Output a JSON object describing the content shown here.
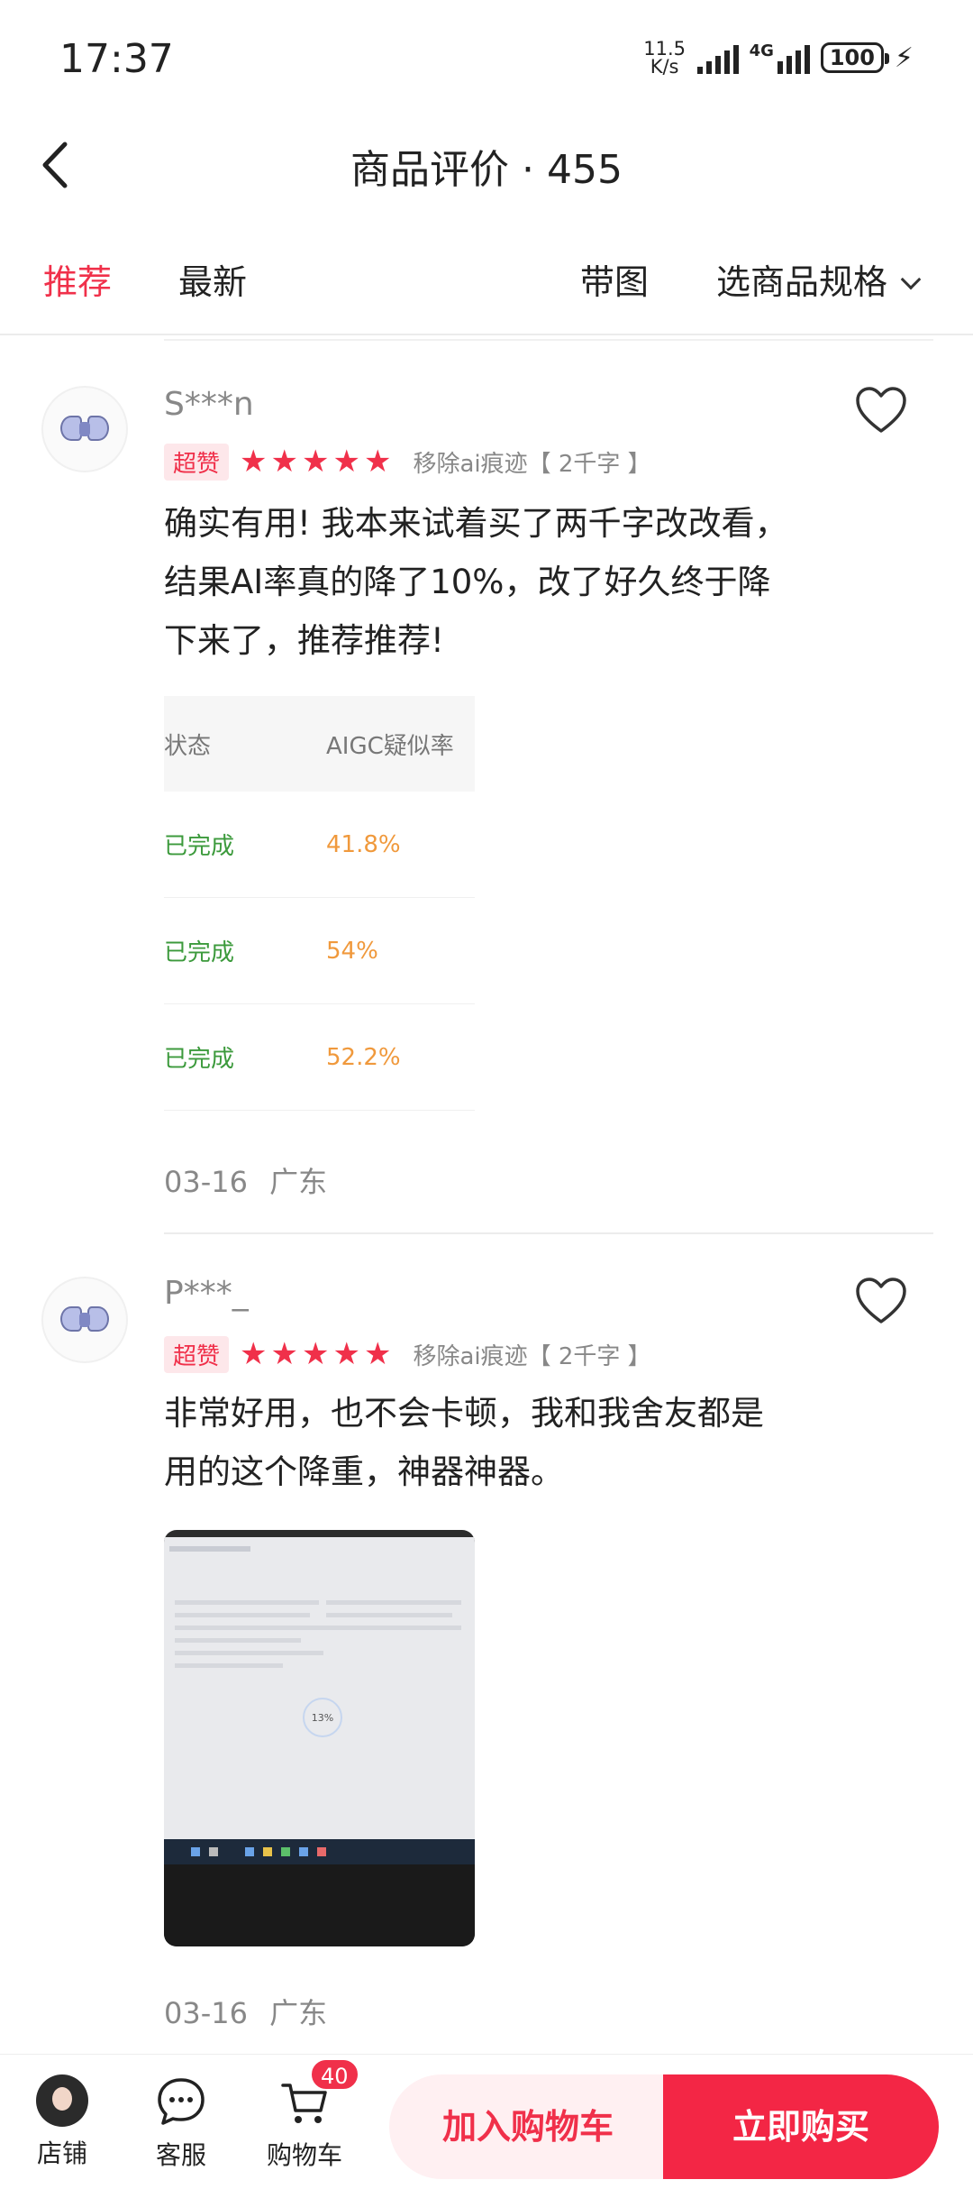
{
  "status_bar": {
    "time": "17:37",
    "net_speed_value": "11.5",
    "net_speed_unit": "K/s",
    "network_type": "4G",
    "battery": "100"
  },
  "header": {
    "title": "商品评价 · 455"
  },
  "tabs": {
    "recommend": "推荐",
    "latest": "最新",
    "with_images": "带图",
    "select_spec": "选商品规格"
  },
  "reviews": [
    {
      "username": "S***n",
      "badge": "超赞",
      "rating": 5,
      "spec": "移除ai痕迹【 2千字 】",
      "content": "确实有用! 我本来试着买了两千字改改看，结果AI率真的降了10%，改了好久终于降下来了，推荐推荐!",
      "image_table": {
        "headers": [
          "状态",
          "AIGC疑似率"
        ],
        "rows": [
          [
            "已完成",
            "41.8%"
          ],
          [
            "已完成",
            "54%"
          ],
          [
            "已完成",
            "52.2%"
          ]
        ]
      },
      "date": "03-16",
      "location": "广东"
    },
    {
      "username": "P***_",
      "badge": "超赞",
      "rating": 5,
      "spec": "移除ai痕迹【 2千字 】",
      "content": "非常好用，也不会卡顿，我和我舍友都是用的这个降重，神器神器。",
      "image_progress": "13%",
      "date": "03-16",
      "location": "广东"
    }
  ],
  "bottom_bar": {
    "store": "店铺",
    "service": "客服",
    "cart": "购物车",
    "cart_count": "40",
    "add_to_cart": "加入购物车",
    "buy_now": "立即购买"
  },
  "colors": {
    "accent": "#f0304a",
    "buy_button": "#f32645",
    "cart_button_bg": "#fff0f2",
    "status_done": "#3c9a3c",
    "rate": "#f0993c"
  }
}
